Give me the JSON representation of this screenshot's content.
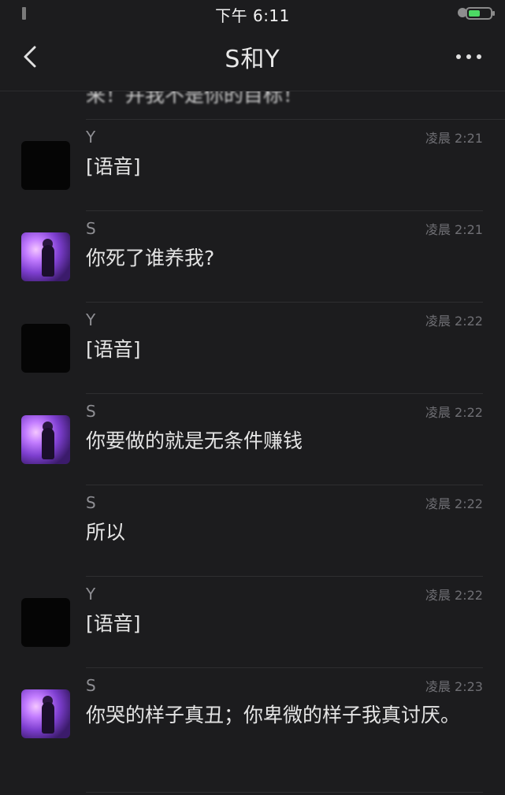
{
  "status_bar": {
    "time": "下午 6:11"
  },
  "nav": {
    "title": "S和Y"
  },
  "partial_message": {
    "text": "来！并我不是你的目标！"
  },
  "messages": [
    {
      "sender": "Y",
      "time": "凌晨 2:21",
      "text": "[语音]",
      "avatar": "Y"
    },
    {
      "sender": "S",
      "time": "凌晨 2:21",
      "text": "你死了谁养我?",
      "avatar": "S"
    },
    {
      "sender": "Y",
      "time": "凌晨 2:22",
      "text": "[语音]",
      "avatar": "Y"
    },
    {
      "sender": "S",
      "time": "凌晨 2:22",
      "text": "你要做的就是无条件赚钱",
      "avatar": "S"
    },
    {
      "sender": "S",
      "time": "凌晨 2:22",
      "text": "所以",
      "avatar": "none"
    },
    {
      "sender": "Y",
      "time": "凌晨 2:22",
      "text": "[语音]",
      "avatar": "Y"
    },
    {
      "sender": "S",
      "time": "凌晨 2:23",
      "text": "你哭的样子真丑；你卑微的样子我真讨厌。",
      "avatar": "S"
    }
  ]
}
